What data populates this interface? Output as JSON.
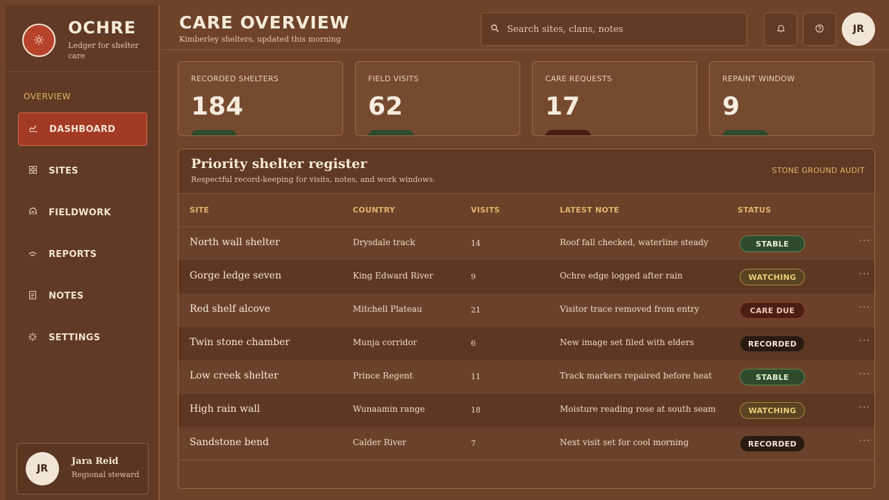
{
  "brand": {
    "name": "OCHRE",
    "subtitle": "Ledger for shelter care",
    "logo_icon": "sun-icon"
  },
  "sidebar": {
    "section_title": "OVERVIEW",
    "items": [
      {
        "label": "DASHBOARD",
        "icon": "chart-icon",
        "active": true
      },
      {
        "label": "SITES",
        "icon": "grid-icon",
        "active": false
      },
      {
        "label": "FIELDWORK",
        "icon": "arch-icon",
        "active": false
      },
      {
        "label": "REPORTS",
        "icon": "signal-icon",
        "active": false
      },
      {
        "label": "NOTES",
        "icon": "note-icon",
        "active": false
      },
      {
        "label": "SETTINGS",
        "icon": "spark-icon",
        "active": false
      }
    ],
    "user": {
      "initials": "JR",
      "name": "Jara Reid",
      "role": "Regional steward"
    }
  },
  "header": {
    "title": "CARE OVERVIEW",
    "subtitle": "Kimberley shelters, updated this morning",
    "search_placeholder": "Search sites, clans, notes",
    "avatar_initials": "JR"
  },
  "stats": [
    {
      "label": "RECORDED SHELTERS",
      "value": "184",
      "chip_color": "#2f4a2c"
    },
    {
      "label": "FIELD VISITS",
      "value": "62",
      "chip_color": "#2f4a2c"
    },
    {
      "label": "CARE REQUESTS",
      "value": "17",
      "chip_color": "#4a1e14"
    },
    {
      "label": "REPAINT WINDOW",
      "value": "9",
      "chip_color": "#2f4a2c"
    }
  ],
  "table": {
    "title": "Priority shelter register",
    "subtitle": "Respectful record-keeping for visits, notes, and work windows.",
    "action": "STONE GROUND AUDIT",
    "columns": {
      "site": "SITE",
      "country": "COUNTRY",
      "visits": "VISITS",
      "note": "LATEST NOTE",
      "status": "STATUS"
    },
    "rows": [
      {
        "site": "North wall shelter",
        "country": "Drysdale track",
        "visits": "14",
        "note": "Roof fall checked, waterline steady",
        "status": "STABLE"
      },
      {
        "site": "Gorge ledge seven",
        "country": "King Edward River",
        "visits": "9",
        "note": "Ochre edge logged after rain",
        "status": "WATCHING"
      },
      {
        "site": "Red shelf alcove",
        "country": "Mitchell Plateau",
        "visits": "21",
        "note": "Visitor trace removed from entry",
        "status": "CARE DUE"
      },
      {
        "site": "Twin stone chamber",
        "country": "Munja corridor",
        "visits": "6",
        "note": "New image set filed with elders",
        "status": "RECORDED"
      },
      {
        "site": "Low creek shelter",
        "country": "Prince Regent",
        "visits": "11",
        "note": "Track markers repaired before heat",
        "status": "STABLE"
      },
      {
        "site": "High rain wall",
        "country": "Wunaamin range",
        "visits": "18",
        "note": "Moisture reading rose at south seam",
        "status": "WATCHING"
      },
      {
        "site": "Sandstone bend",
        "country": "Calder River",
        "visits": "7",
        "note": "Next visit set for cool morning",
        "status": "RECORDED"
      }
    ],
    "status_styles": {
      "STABLE": {
        "bg": "#2f4a2c",
        "fg": "#e3efd6",
        "border": "#5d8a55"
      },
      "WATCHING": {
        "bg": "#5a4320",
        "fg": "#eccd7a",
        "border": "#a88a45"
      },
      "CARE DUE": {
        "bg": "#4a1e14",
        "fg": "#f0c2ae",
        "border": "#8f3b28"
      },
      "RECORDED": {
        "bg": "#2a1a10",
        "fg": "#f1e6d6",
        "border": "#5a3e2a"
      }
    }
  }
}
